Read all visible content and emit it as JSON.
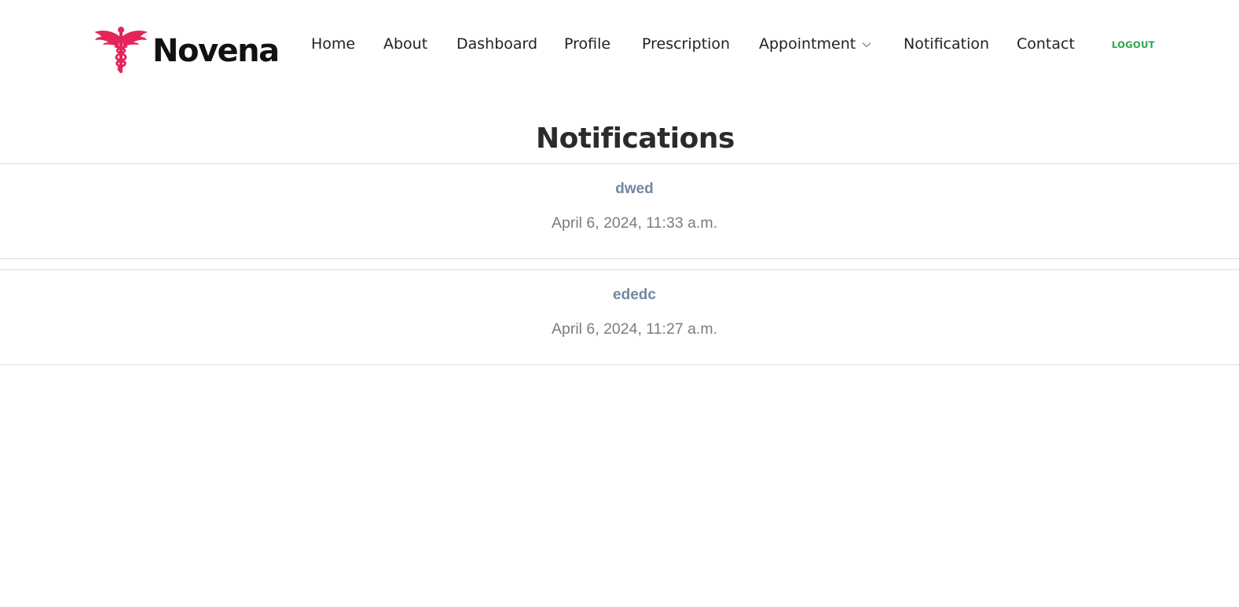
{
  "brand": {
    "name": "Novena",
    "logo_icon": "caduceus-icon",
    "logo_color": "#e5245a"
  },
  "nav": {
    "items": [
      {
        "label": "Home"
      },
      {
        "label": "About"
      },
      {
        "label": "Dashboard"
      },
      {
        "label": "Profile"
      },
      {
        "label": "Prescription"
      },
      {
        "label": "Appointment",
        "icon": "chevron-down-icon"
      },
      {
        "label": "Notification"
      },
      {
        "label": "Contact"
      }
    ],
    "logout_label": "LOGOUT",
    "logout_color": "#2ea34a"
  },
  "page": {
    "title": "Notifications"
  },
  "notifications": [
    {
      "title": "dwed",
      "timestamp": "April 6, 2024, 11:33 a.m."
    },
    {
      "title": "ededc",
      "timestamp": "April 6, 2024, 11:27 a.m."
    }
  ],
  "colors": {
    "notification_title": "#7088a1",
    "timestamp": "#7c7c7c",
    "divider": "#dcdcdc"
  }
}
